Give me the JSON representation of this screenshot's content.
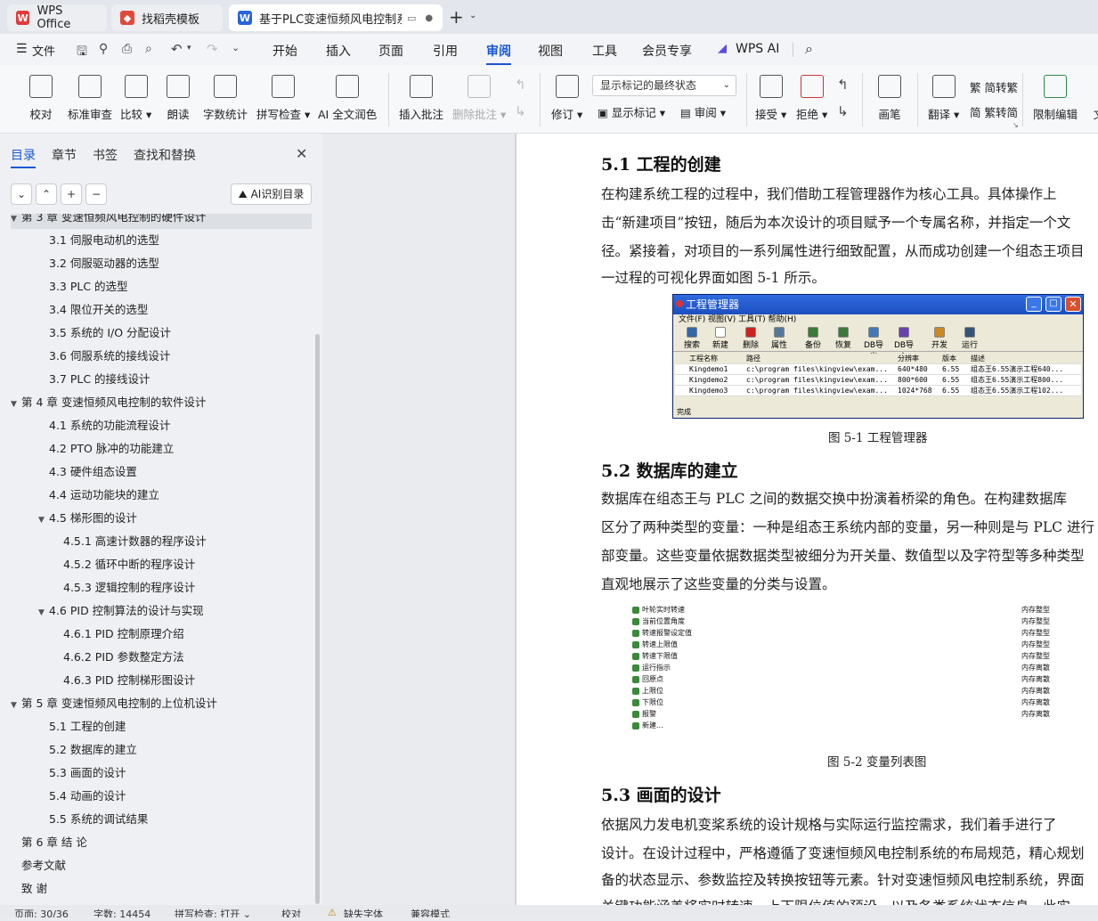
{
  "tabs": [
    {
      "label": "WPS Office"
    },
    {
      "label": "找稻壳模板"
    },
    {
      "label": "基于PLC变速恒频风电控制系"
    }
  ],
  "menu": {
    "file": "文件",
    "items": [
      "开始",
      "插入",
      "页面",
      "引用",
      "审阅",
      "视图",
      "工具",
      "会员专享",
      "WPS AI"
    ],
    "active": "审阅"
  },
  "ribbon": {
    "proofread": "校对",
    "std_review": "标准审查",
    "compare": "比较",
    "read_aloud": "朗读",
    "word_count": "字数统计",
    "spell_check": "拼写检查",
    "ai_polish": "AI 全文润色",
    "insert_comment": "插入批注",
    "delete_comment": "删除批注",
    "track": "修订",
    "markup_select": "显示标记的最终状态",
    "show_markup": "显示标记",
    "review": "审阅",
    "accept": "接受",
    "reject": "拒绝",
    "pen": "画笔",
    "translate": "翻译",
    "to_trad": "简转繁",
    "to_simp": "繁转简",
    "restrict_edit": "限制编辑",
    "doc_cut": "文"
  },
  "pane": {
    "tabs": [
      "目录",
      "章节",
      "书签",
      "查找和替换"
    ],
    "ai_toc": "AI识别目录",
    "toc": [
      {
        "level": 1,
        "text": "第 3 章  变速恒频风电控制的硬件设计",
        "expand": "▼"
      },
      {
        "level": 2,
        "text": "3.1  伺服电动机的选型"
      },
      {
        "level": 2,
        "text": "3.2  伺服驱动器的选型"
      },
      {
        "level": 2,
        "text": "3.3 PLC 的选型"
      },
      {
        "level": 2,
        "text": "3.4  限位开关的选型"
      },
      {
        "level": 2,
        "text": "3.5  系统的 I/O 分配设计"
      },
      {
        "level": 2,
        "text": "3.6  伺服系统的接线设计"
      },
      {
        "level": 2,
        "text": "3.7 PLC 的接线设计"
      },
      {
        "level": 1,
        "text": "第 4 章  变速恒频风电控制的软件设计",
        "expand": "▼"
      },
      {
        "level": 2,
        "text": "4.1  系统的功能流程设计"
      },
      {
        "level": 2,
        "text": "4.2 PTO 脉冲的功能建立"
      },
      {
        "level": 2,
        "text": "4.3  硬件组态设置"
      },
      {
        "level": 2,
        "text": "4.4  运动功能块的建立"
      },
      {
        "level": 2,
        "text": "4.5  梯形图的设计",
        "expand": "▼"
      },
      {
        "level": 3,
        "text": "4.5.1  高速计数器的程序设计"
      },
      {
        "level": 3,
        "text": "4.5.2  循环中断的程序设计"
      },
      {
        "level": 3,
        "text": "4.5.3  逻辑控制的程序设计"
      },
      {
        "level": 2,
        "text": "4.6 PID 控制算法的设计与实现",
        "expand": "▼"
      },
      {
        "level": 3,
        "text": "4.6.1 PID 控制原理介绍"
      },
      {
        "level": 3,
        "text": "4.6.2 PID 参数整定方法"
      },
      {
        "level": 3,
        "text": "4.6.3 PID 控制梯形图设计"
      },
      {
        "level": 1,
        "text": "第 5 章  变速恒频风电控制的上位机设计",
        "expand": "▼"
      },
      {
        "level": 2,
        "text": "5.1  工程的创建"
      },
      {
        "level": 2,
        "text": "5.2  数据库的建立"
      },
      {
        "level": 2,
        "text": "5.3  画面的设计"
      },
      {
        "level": 2,
        "text": "5.4  动画的设计"
      },
      {
        "level": 2,
        "text": "5.5  系统的调试结果"
      },
      {
        "level": 1,
        "text": "第 6 章  结    论"
      },
      {
        "level": 1,
        "text": "参考文献"
      },
      {
        "level": 1,
        "text": "致    谢"
      }
    ]
  },
  "doc": {
    "h51": "5.1  工程的创建",
    "p51": [
      "    在构建系统工程的过程中，我们借助工程管理器作为核心工具。具体操作上",
      "击“新建项目”按钮，随后为本次设计的项目赋予一个专属名称，并指定一个文",
      "径。紧接着，对项目的一系列属性进行细致配置，从而成功创建一个组态王项目",
      "一过程的可视化界面如图 5-1 所示。"
    ],
    "fig1": {
      "title": "工程管理器",
      "menu": "文件(F)   视图(V)   工具(T)   帮助(H)",
      "tools": [
        "搜索",
        "新建",
        "删除",
        "属性",
        "备份",
        "恢复",
        "DB导出",
        "DB导入",
        "开发",
        "运行"
      ],
      "headers": [
        "工程名称",
        "路径",
        "分辨率",
        "版本",
        "描述"
      ],
      "rows": [
        [
          "Kingdemo1",
          "c:\\program files\\kingview\\exam...",
          "640*480",
          "6.55",
          "组态王6.55演示工程640..."
        ],
        [
          "Kingdemo2",
          "c:\\program files\\kingview\\exam...",
          "800*600",
          "6.55",
          "组态王6.55演示工程800..."
        ],
        [
          "Kingdemo3",
          "c:\\program files\\kingview\\exam...",
          "1024*768",
          "6.55",
          "组态王6.55演示工程102..."
        ]
      ],
      "status": "完成"
    },
    "cap1": "图 5-1  工程管理器",
    "h52": "5.2  数据库的建立",
    "p52": [
      "    数据库在组态王与 PLC 之间的数据交换中扮演着桥梁的角色。在构建数据库",
      "区分了两种类型的变量：一种是组态王系统内部的变量，另一种则是与 PLC 进行",
      "部变量。这些变量依据数据类型被细分为开关量、数值型以及字符型等多种类型",
      "直观地展示了这些变量的分类与设置。"
    ],
    "fig2": {
      "vars": [
        "叶轮实时转速",
        "当前位置角度",
        "转速报警设定值",
        "转速上限值",
        "转速下限值",
        "运行指示",
        "回原点",
        "上限位",
        "下限位",
        "报警",
        "新建..."
      ],
      "types": [
        "内存整型",
        "内存整型",
        "内存整型",
        "内存整型",
        "内存整型",
        "内存离散",
        "内存离散",
        "内存离散",
        "内存离散",
        "内存离散"
      ]
    },
    "cap2": "图 5-2  变量列表图",
    "h53": "5.3  画面的设计",
    "p53": [
      "    依据风力发电机变桨系统的设计规格与实际运行监控需求，我们着手进行了",
      "设计。在设计过程中，严格遵循了变速恒频风电控制系统的布局规范，精心规划",
      "备的状态显示、参数监控及转换按钮等元素。针对变速恒频风电控制系统，界面",
      "关键功能涵盖将实时转速、上下限位值的预设，以及各类系统状态信息。此实"
    ]
  },
  "status": {
    "page": "页面: 30/36",
    "words": "字数: 14454",
    "spell": "拼写检查: 打开",
    "proof": "校对",
    "missing_font": "缺失字体",
    "compat": "兼容模式"
  }
}
